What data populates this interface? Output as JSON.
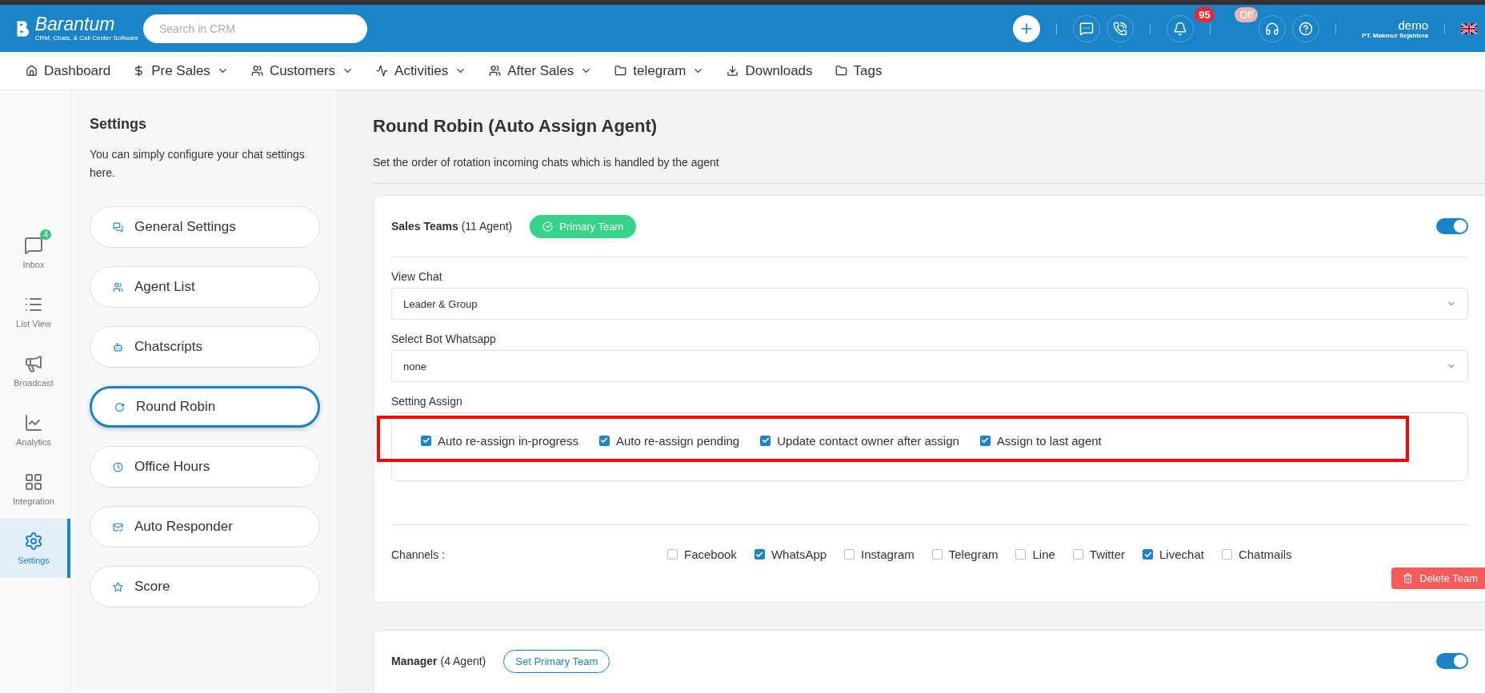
{
  "header": {
    "logo": {
      "name": "Barantum",
      "tagline": "CRM, Chats, & Call Center Software"
    },
    "search": {
      "placeholder": "Search in CRM"
    },
    "notification_count": "95",
    "phone_status": "Off",
    "user": {
      "name": "demo",
      "company": "PT. Makmur Sejahtera"
    }
  },
  "nav": [
    {
      "label": "Dashboard",
      "dropdown": false
    },
    {
      "label": "Pre Sales",
      "dropdown": true
    },
    {
      "label": "Customers",
      "dropdown": true
    },
    {
      "label": "Activities",
      "dropdown": true
    },
    {
      "label": "After Sales",
      "dropdown": true
    },
    {
      "label": "telegram",
      "dropdown": true
    },
    {
      "label": "Downloads",
      "dropdown": false
    },
    {
      "label": "Tags",
      "dropdown": false
    }
  ],
  "rail": [
    {
      "label": "Inbox",
      "badge": "4",
      "selected": false
    },
    {
      "label": "List View",
      "selected": false
    },
    {
      "label": "Broadcast",
      "selected": false
    },
    {
      "label": "Analytics",
      "selected": false
    },
    {
      "label": "Integration",
      "selected": false
    },
    {
      "label": "Settings",
      "selected": true
    }
  ],
  "settings_panel": {
    "title": "Settings",
    "description": "You can simply configure your chat settings here.",
    "items": [
      {
        "label": "General Settings",
        "selected": false
      },
      {
        "label": "Agent List",
        "selected": false
      },
      {
        "label": "Chatscripts",
        "selected": false
      },
      {
        "label": "Round Robin",
        "selected": true
      },
      {
        "label": "Office Hours",
        "selected": false
      },
      {
        "label": "Auto Responder",
        "selected": false
      },
      {
        "label": "Score",
        "selected": false
      }
    ]
  },
  "main": {
    "title": "Round Robin (Auto Assign Agent)",
    "subtitle": "Set the order of rotation incoming chats which is handled by the agent",
    "teams": [
      {
        "name": "Sales Teams",
        "count": "(11 Agent)",
        "primary": true,
        "primary_label": "Primary Team",
        "on": true,
        "fields": [
          {
            "label": "View Chat",
            "value": "Leader & Group"
          },
          {
            "label": "Select Bot Whatsapp",
            "value": "none"
          }
        ],
        "assign_label": "Setting Assign",
        "highlighted": true,
        "assign_options": [
          {
            "label": "Auto re-assign in-progress",
            "checked": true
          },
          {
            "label": "Auto re-assign pending",
            "checked": true
          },
          {
            "label": "Update contact owner after assign",
            "checked": true
          },
          {
            "label": "Assign to last agent",
            "checked": true
          }
        ],
        "channels_label": "Channels :",
        "channels": [
          {
            "label": "Facebook",
            "checked": false
          },
          {
            "label": "WhatsApp",
            "checked": true
          },
          {
            "label": "Instagram",
            "checked": false
          },
          {
            "label": "Telegram",
            "checked": false
          },
          {
            "label": "Line",
            "checked": false
          },
          {
            "label": "Twitter",
            "checked": false
          },
          {
            "label": "Livechat",
            "checked": true
          },
          {
            "label": "Chatmails",
            "checked": false
          }
        ],
        "delete_label": "Delete Team"
      },
      {
        "name": "Manager",
        "count": "(4 Agent)",
        "primary": false,
        "primary_label": "Set Primary Team",
        "on": true
      }
    ]
  }
}
